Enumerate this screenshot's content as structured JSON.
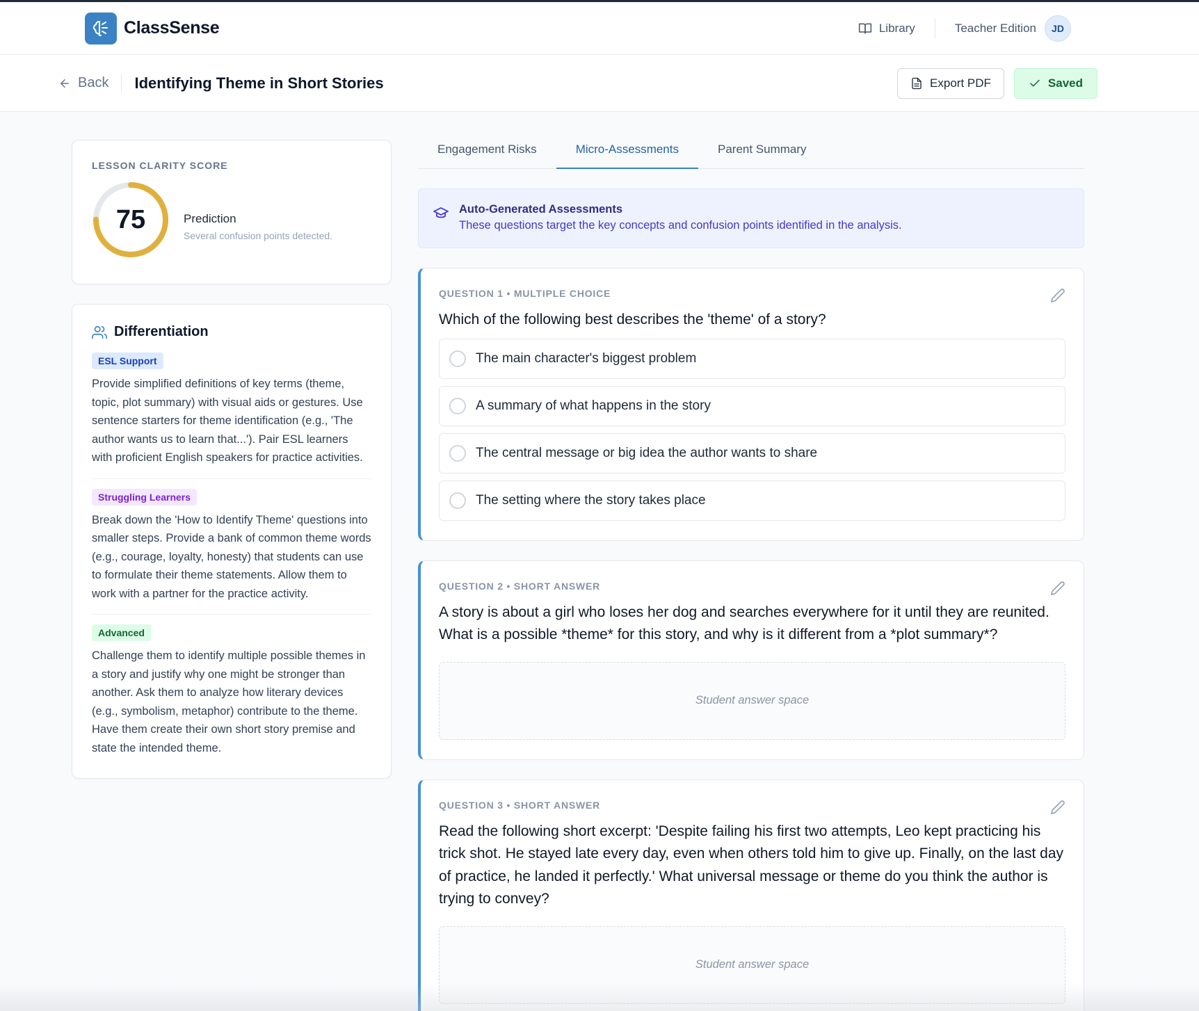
{
  "app": {
    "name": "ClassSense"
  },
  "topbar": {
    "library_label": "Library",
    "edition_label": "Teacher Edition",
    "avatar_initials": "JD"
  },
  "subbar": {
    "back_label": "Back",
    "title": "Identifying Theme in Short Stories",
    "export_label": "Export PDF",
    "saved_label": "Saved"
  },
  "score": {
    "kicker": "LESSON CLARITY SCORE",
    "value": "75",
    "value_fraction": 0.75,
    "prediction_title": "Prediction",
    "prediction_sub": "Several confusion points detected.",
    "ring_color": "#e0b03f"
  },
  "differentiation": {
    "title": "Differentiation",
    "groups": [
      {
        "tag": "ESL Support",
        "text": "Provide simplified definitions of key terms (theme, topic, plot summary) with visual aids or gestures. Use sentence starters for theme identification (e.g., 'The author wants us to learn that...'). Pair ESL learners with proficient English speakers for practice activities."
      },
      {
        "tag": "Struggling Learners",
        "text": "Break down the 'How to Identify Theme' questions into smaller steps. Provide a bank of common theme words (e.g., courage, loyalty, honesty) that students can use to formulate their theme statements. Allow them to work with a partner for the practice activity."
      },
      {
        "tag": "Advanced",
        "text": "Challenge them to identify multiple possible themes in a story and justify why one might be stronger than another. Ask them to analyze how literary devices (e.g., symbolism, metaphor) contribute to the theme. Have them create their own short story premise and state the intended theme."
      }
    ]
  },
  "tabs": [
    {
      "label": "Engagement Risks"
    },
    {
      "label": "Micro-Assessments"
    },
    {
      "label": "Parent Summary"
    }
  ],
  "info": {
    "title": "Auto-Generated Assessments",
    "subtitle": "These questions target the key concepts and confusion points identified in the analysis."
  },
  "questions": [
    {
      "kicker": "QUESTION 1 • MULTIPLE CHOICE",
      "text": "Which of the following best describes the 'theme' of a story?",
      "options": [
        "The main character's biggest problem",
        "A summary of what happens in the story",
        "The central message or big idea the author wants to share",
        "The setting where the story takes place"
      ]
    },
    {
      "kicker": "QUESTION 2 • SHORT ANSWER",
      "text": "A story is about a girl who loses her dog and searches everywhere for it until they are reunited. What is a possible *theme* for this story, and why is it different from a *plot summary*?",
      "answer_placeholder": "Student answer space"
    },
    {
      "kicker": "QUESTION 3 • SHORT ANSWER",
      "text": "Read the following short excerpt: 'Despite failing his first two attempts, Leo kept practicing his trick shot. He stayed late every day, even when others told him to give up. Finally, on the last day of practice, he landed it perfectly.' What universal message or theme do you think the author is trying to convey?",
      "answer_placeholder": "Student answer space"
    }
  ]
}
